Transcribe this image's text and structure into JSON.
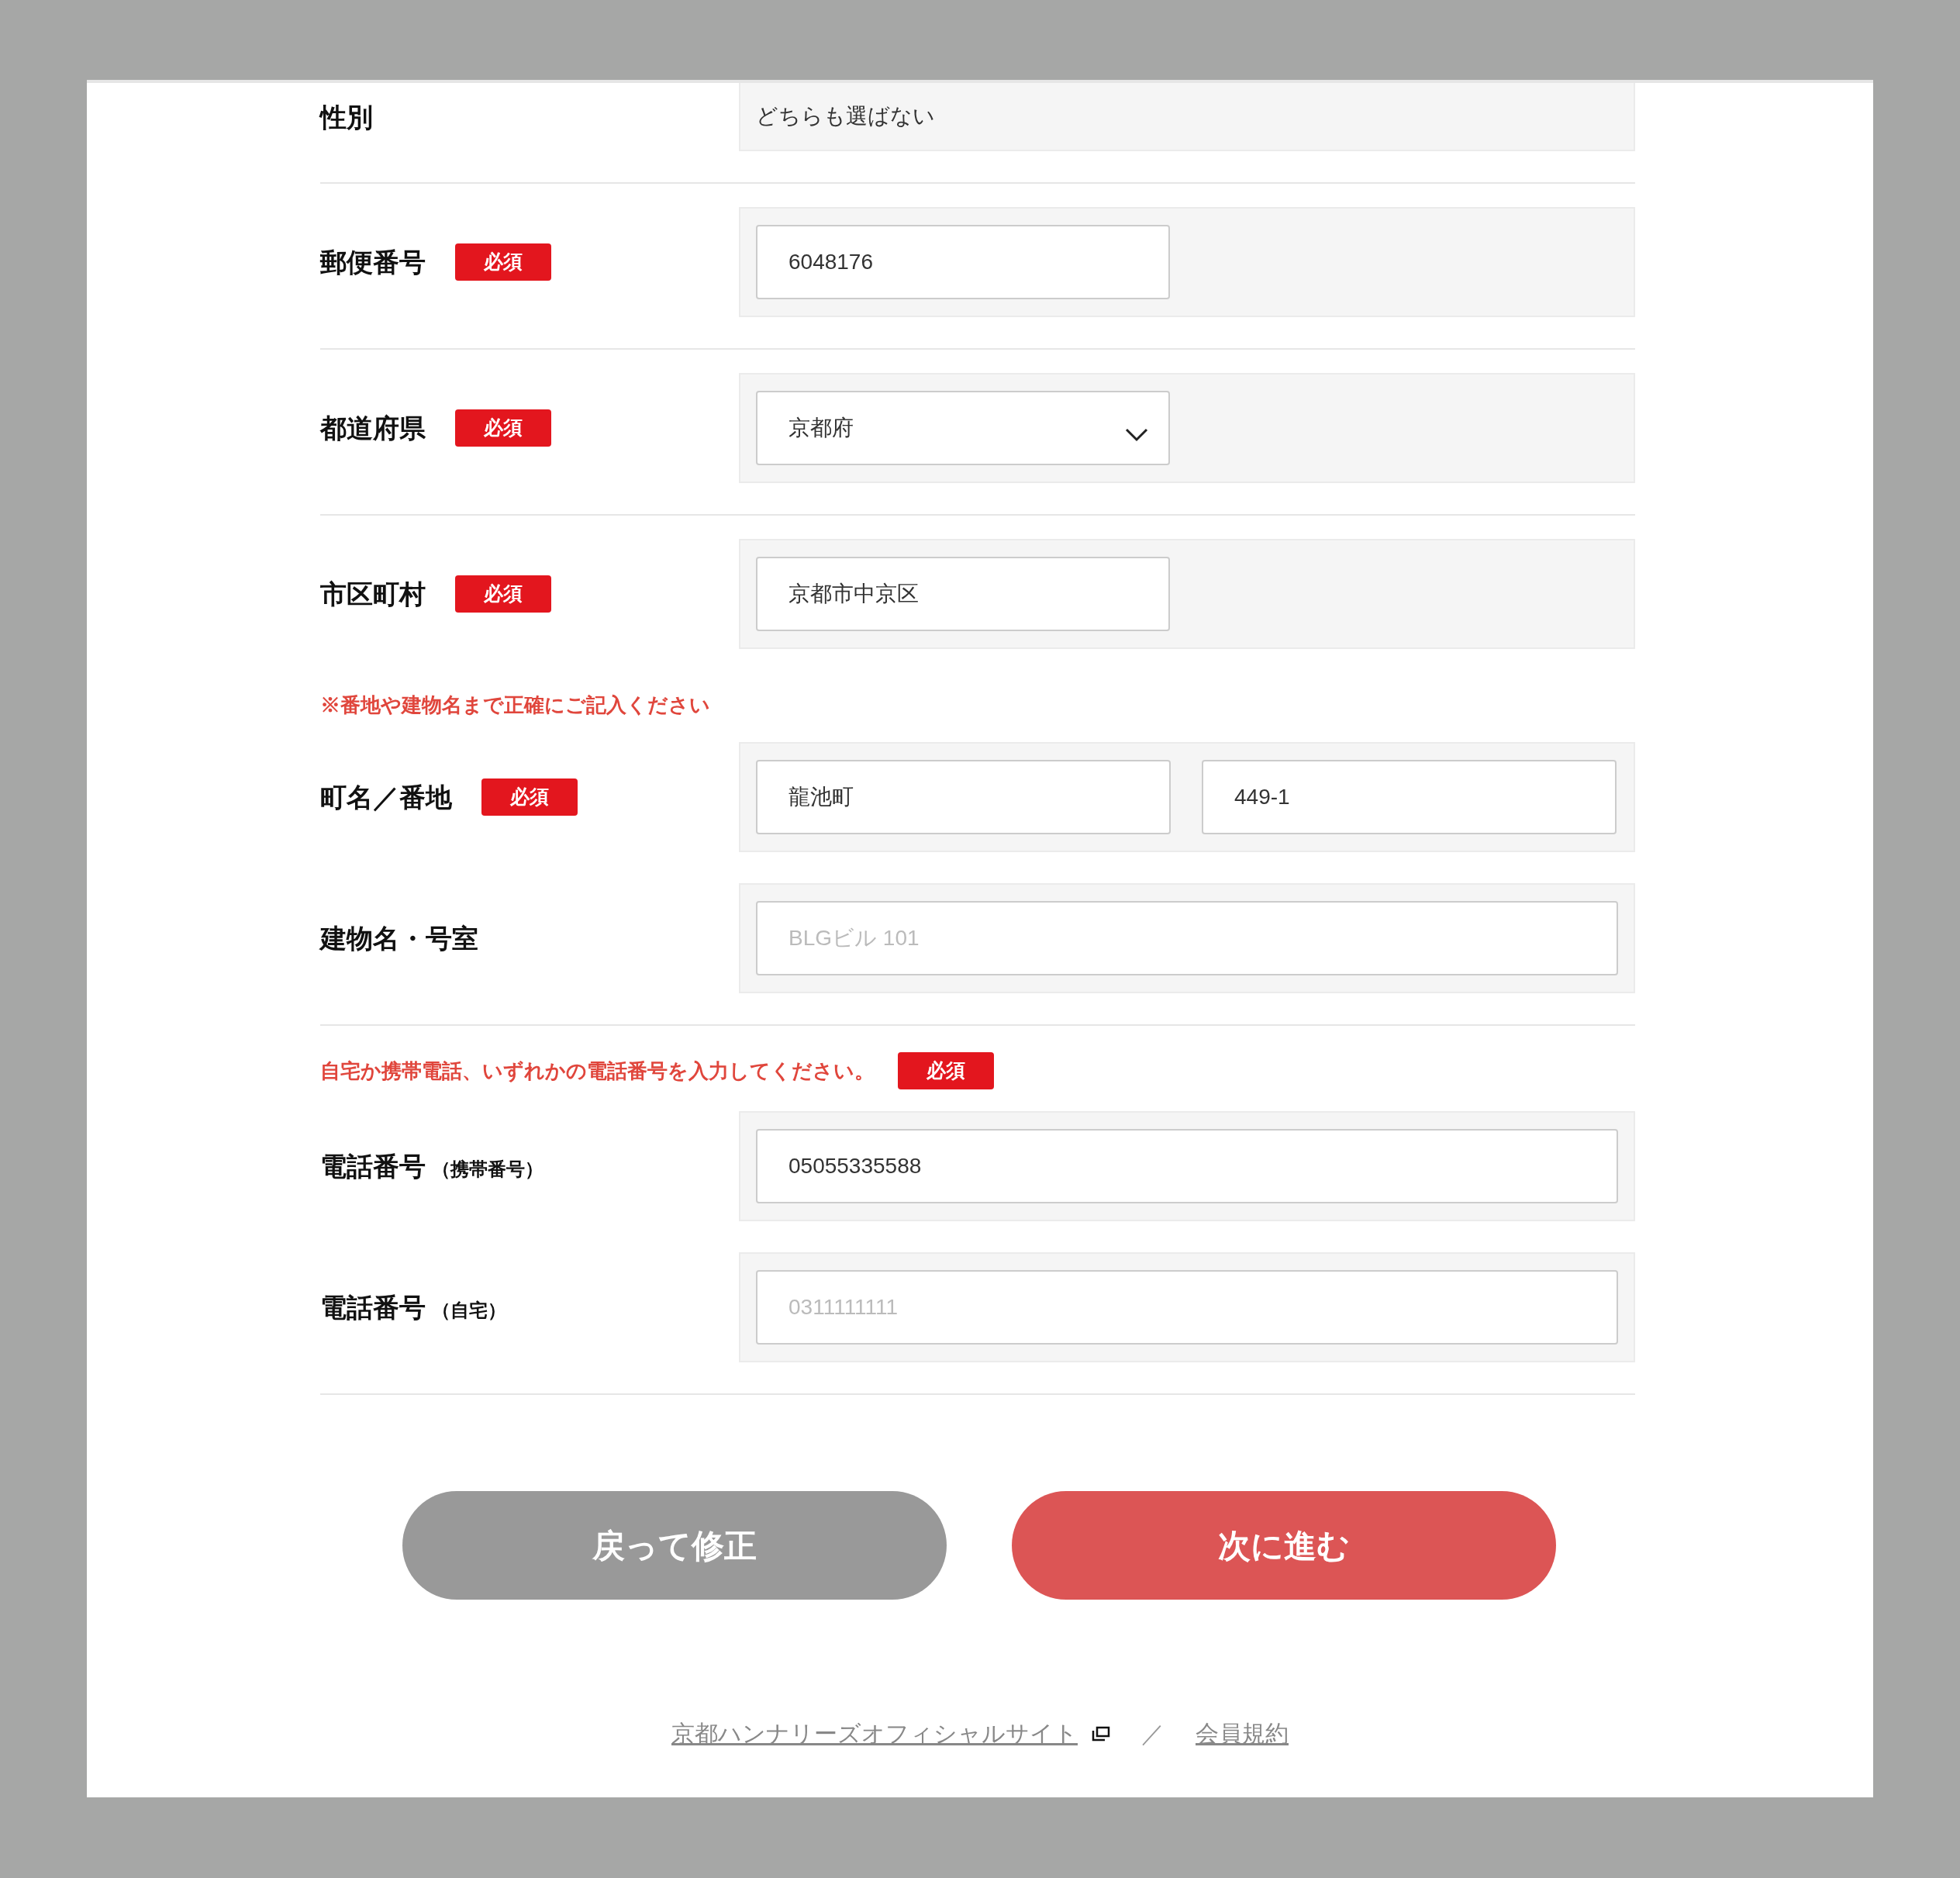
{
  "rows": [
    {
      "kind": "static",
      "label": "性別",
      "value": "どちらも選ばない",
      "divider_after": true
    },
    {
      "kind": "short",
      "label": "郵便番号",
      "badge": "必須",
      "fields": [
        {
          "value": "6048176"
        }
      ],
      "divider_after": true
    },
    {
      "kind": "select",
      "label": "都道府県",
      "badge": "必須",
      "fields": [
        {
          "value": "京都府"
        }
      ],
      "divider_after": true
    },
    {
      "kind": "short",
      "label": "市区町村",
      "badge": "必須",
      "fields": [
        {
          "value": "京都市中京区"
        }
      ],
      "divider_after": false
    },
    {
      "kind": "note",
      "text": "※番地や建物名まで正確にご記入ください"
    },
    {
      "kind": "pair",
      "label": "町名／番地",
      "badge": "必須",
      "fields": [
        {
          "value": "龍池町"
        },
        {
          "value": "449-1"
        }
      ],
      "divider_after": false
    },
    {
      "kind": "full",
      "label": "建物名・号室",
      "fields": [
        {
          "placeholder": "BLGビル 101"
        }
      ],
      "divider_after": true
    },
    {
      "kind": "note",
      "text": "自宅か携帯電話、いずれかの電話番号を入力してください。",
      "badge": "必須"
    },
    {
      "kind": "full",
      "label": "電話番号",
      "suffix": "（携帯番号）",
      "fields": [
        {
          "value": "05055335588"
        }
      ],
      "divider_after": false
    },
    {
      "kind": "full",
      "label": "電話番号",
      "suffix": "（自宅）",
      "fields": [
        {
          "placeholder": "0311111111"
        }
      ],
      "divider_after": true
    }
  ],
  "buttons": [
    {
      "kind": "back",
      "label": "戻って修正"
    },
    {
      "kind": "next",
      "label": "次に進む"
    }
  ],
  "footer": {
    "links": [
      {
        "label": "京都ハンナリーズオフィシャルサイト",
        "external": true
      },
      {
        "label": "会員規約",
        "external": false
      }
    ],
    "separator": "／"
  }
}
